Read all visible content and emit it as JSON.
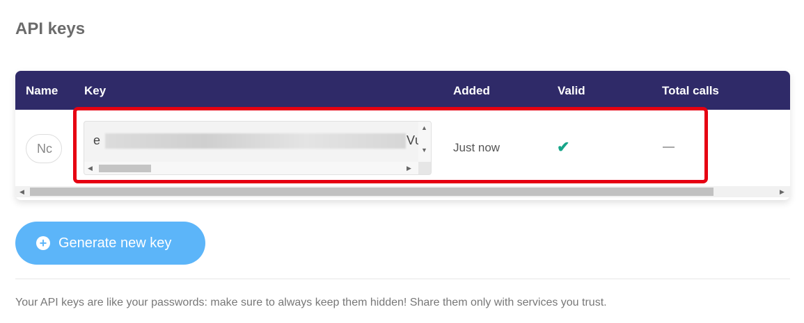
{
  "page": {
    "title": "API keys"
  },
  "table": {
    "headers": [
      "Name",
      "Key",
      "Added",
      "Valid",
      "Total calls"
    ],
    "rows": [
      {
        "name": "Nc",
        "key_start": "e",
        "key_end": "Vυ",
        "added": "Just now",
        "valid": "✔",
        "total_calls": "—"
      }
    ]
  },
  "actions": {
    "generate_label": "Generate new key"
  },
  "footer": {
    "note": "Your API keys are like your passwords: make sure to always keep them hidden! Share them only with services you trust."
  },
  "colors": {
    "header_bg": "#2f2a68",
    "button": "#5cb5f9",
    "valid_check": "#17a589",
    "highlight": "#e60012"
  },
  "icons": {
    "valid": "checkmark-icon",
    "add": "plus-circle-icon"
  }
}
